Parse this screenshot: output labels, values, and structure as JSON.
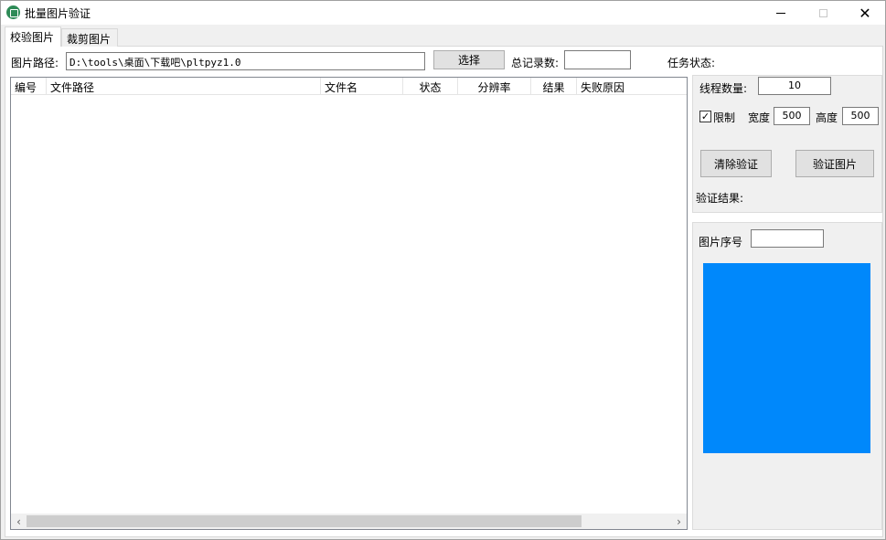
{
  "window": {
    "title": "批量图片验证"
  },
  "tabs": [
    {
      "label": "校验图片"
    },
    {
      "label": "裁剪图片"
    }
  ],
  "toolbar": {
    "path_label": "图片路径:",
    "path_value": "D:\\tools\\桌面\\下载吧\\pltpyz1.0",
    "select_button": "选择",
    "total_label": "总记录数:",
    "total_value": "",
    "task_status_label": "任务状态:"
  },
  "grid": {
    "columns": [
      "编号",
      "文件路径",
      "文件名",
      "状态",
      "分辨率",
      "结果",
      "失败原因"
    ],
    "rows": []
  },
  "settings": {
    "thread_label": "线程数量:",
    "thread_value": "10",
    "limit_label": "限制",
    "limit_checked": "✓",
    "width_label": "宽度",
    "width_value": "500",
    "height_label": "高度",
    "height_value": "500",
    "clear_button": "清除验证",
    "verify_button": "验证图片",
    "result_label": "验证结果:"
  },
  "preview": {
    "index_label": "图片序号",
    "index_value": "",
    "color": "#0088fb"
  }
}
